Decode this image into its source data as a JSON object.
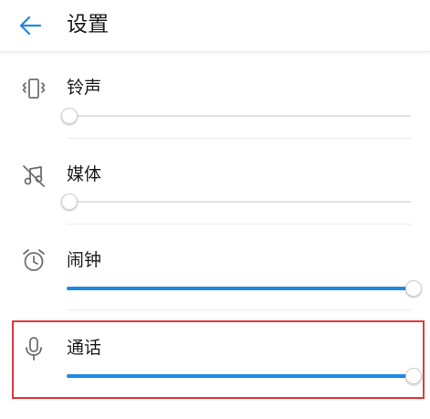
{
  "header": {
    "title": "设置",
    "back_icon": "arrow-left-icon"
  },
  "volumes": [
    {
      "id": "ringtone",
      "label": "铃声",
      "icon": "vibrate-icon",
      "level": 0.0
    },
    {
      "id": "media",
      "label": "媒体",
      "icon": "music-off-icon",
      "level": 0.0
    },
    {
      "id": "alarm",
      "label": "闹钟",
      "icon": "alarm-clock-icon",
      "level": 1.0
    },
    {
      "id": "call",
      "label": "通话",
      "icon": "microphone-icon",
      "level": 1.0
    }
  ],
  "highlight": {
    "target": "call",
    "color": "#e0393e"
  },
  "colors": {
    "accent": "#1e88e5",
    "track": "#e3e3e3",
    "icon": "#6f6f6f"
  }
}
